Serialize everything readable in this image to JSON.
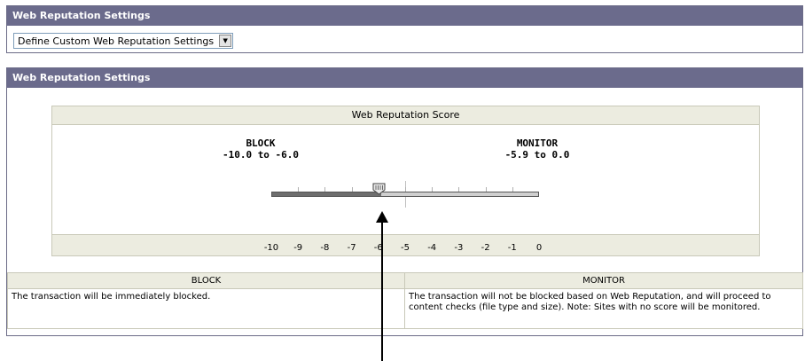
{
  "panel_top": {
    "title": "Web Reputation Settings",
    "select_value": "Define Custom Web Reputation Settings"
  },
  "panel_main": {
    "title": "Web Reputation Settings",
    "score_title": "Web Reputation Score",
    "zones": {
      "block": {
        "name": "BLOCK",
        "range": "-10.0 to -6.0"
      },
      "monitor": {
        "name": "MONITOR",
        "range": "-5.9 to 0.0"
      }
    },
    "scale_labels": [
      "-10",
      "-9",
      "-8",
      "-7",
      "-6",
      "-5",
      "-4",
      "-3",
      "-2",
      "-1",
      "0"
    ],
    "slider_value": -6.0,
    "table": {
      "headers": [
        "BLOCK",
        "MONITOR"
      ],
      "rows": [
        [
          "The transaction will be immediately blocked.",
          "The transaction will not be blocked based on Web Reputation, and will proceed to content checks (file type and size). Note: Sites with no score will be monitored."
        ]
      ]
    }
  },
  "colors": {
    "header_bg": "#6b6b8c",
    "band_bg": "#ecece0",
    "block_track": "#6e6e6e",
    "monitor_track": "#cfcfcf"
  },
  "icons": {
    "dropdown": "chevron-down-icon",
    "slider_thumb": "slider-thumb-icon",
    "annotation": "arrow-up-icon"
  }
}
